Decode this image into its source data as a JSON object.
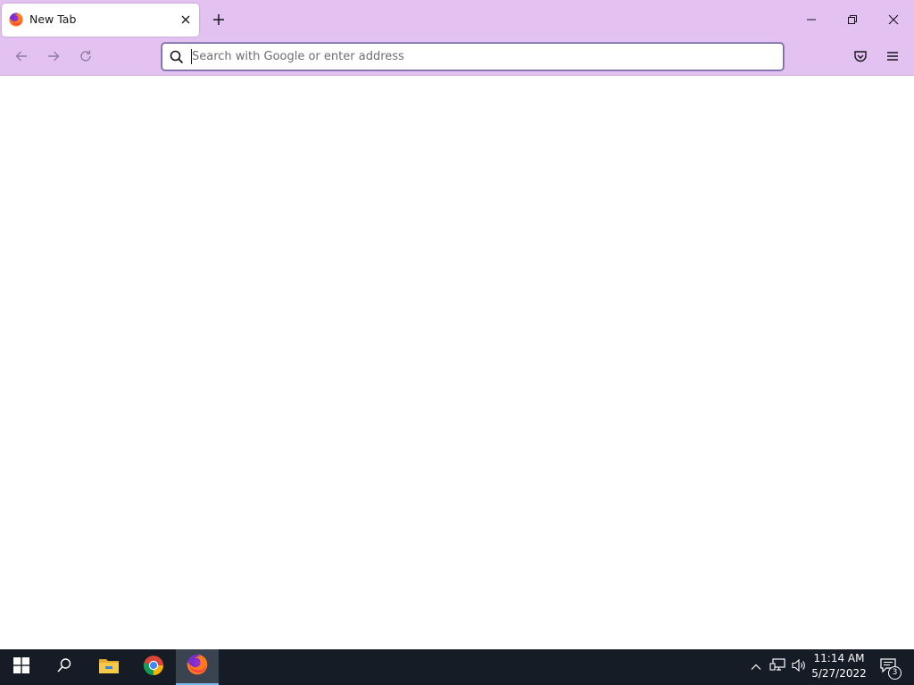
{
  "browser": {
    "tab": {
      "title": "New Tab",
      "favicon_icon": "firefox-logo-icon",
      "close_icon": "close-icon"
    },
    "new_tab_icon": "plus-icon",
    "window_controls": {
      "minimize_icon": "minimize-icon",
      "restore_icon": "restore-icon",
      "close_icon": "close-icon"
    },
    "nav": {
      "back_icon": "arrow-left-icon",
      "forward_icon": "arrow-right-icon",
      "reload_icon": "reload-icon"
    },
    "urlbar": {
      "placeholder": "Search with Google or enter address",
      "value": "",
      "search_icon": "search-icon"
    },
    "toolbar_right": {
      "pocket_icon": "pocket-icon",
      "menu_icon": "hamburger-menu-icon"
    },
    "colors": {
      "chrome": "#e3c2f2",
      "content": "#ffffff"
    }
  },
  "taskbar": {
    "start_icon": "windows-start-icon",
    "search_icon": "search-icon",
    "pinned": [
      {
        "name": "File Explorer",
        "icon": "folder-icon"
      },
      {
        "name": "Google Chrome",
        "icon": "chrome-icon"
      },
      {
        "name": "Firefox",
        "icon": "firefox-icon",
        "active": true
      }
    ],
    "tray": {
      "chevron_icon": "chevron-up-icon",
      "network_icon": "network-icon",
      "volume_icon": "volume-icon"
    },
    "clock": {
      "time": "11:14 AM",
      "date": "5/27/2022"
    },
    "notifications": {
      "count": "3",
      "icon": "action-center-icon"
    },
    "colors": {
      "background": "#151c25",
      "active_accent": "#76b9ed"
    }
  }
}
